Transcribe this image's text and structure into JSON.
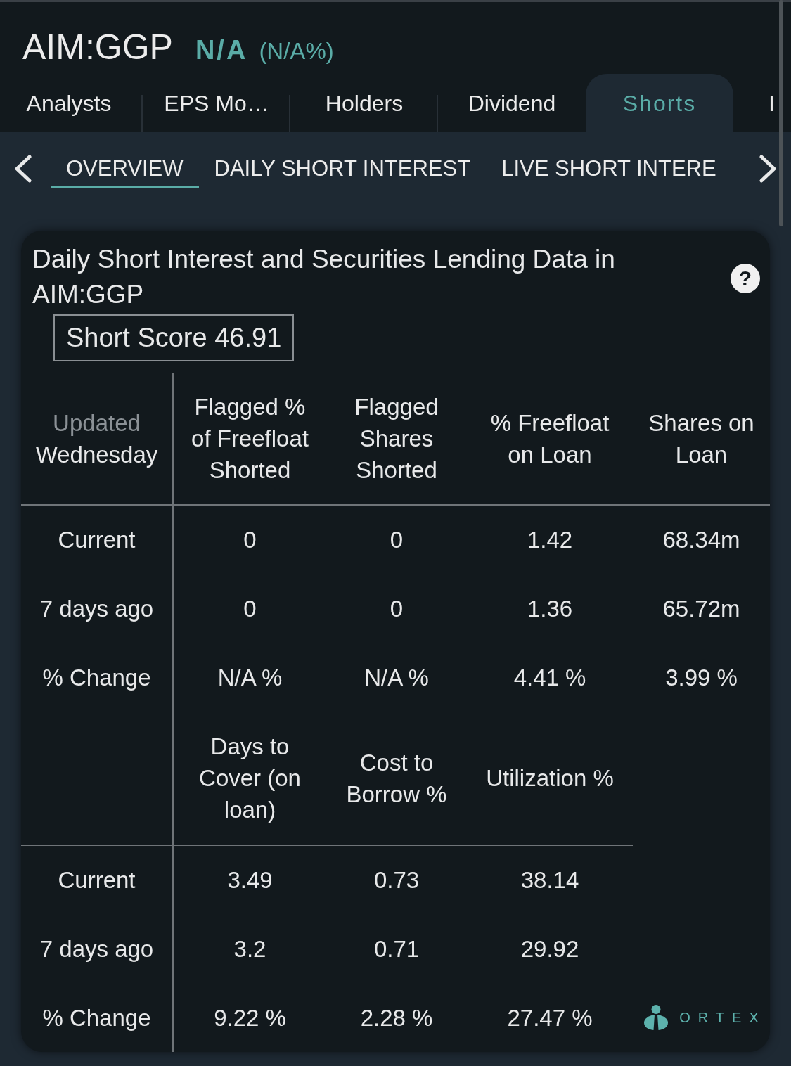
{
  "header": {
    "symbol": "AIM:GGP",
    "price": "N/A",
    "change": "(N/A%)"
  },
  "tabs": [
    {
      "label": "Analysts",
      "selected": false
    },
    {
      "label": "EPS Mo…",
      "selected": false
    },
    {
      "label": "Holders",
      "selected": false
    },
    {
      "label": "Dividend",
      "selected": false
    },
    {
      "label": "Shorts",
      "selected": true
    },
    {
      "label": "I",
      "selected": false
    }
  ],
  "subtabs": [
    {
      "label": "OVERVIEW",
      "selected": true
    },
    {
      "label": "DAILY SHORT INTEREST",
      "selected": false
    },
    {
      "label": "LIVE SHORT INTERE",
      "selected": false
    }
  ],
  "card": {
    "title": "Daily Short Interest and Securities Lending Data in AIM:GGP",
    "help": "?",
    "short_score": "Short Score 46.91",
    "sections": [
      {
        "corner": {
          "label": "Updated",
          "value": "Wednesday"
        },
        "columns": [
          "Flagged % of Freefloat Shorted",
          "Flagged Shares Shorted",
          "% Freefloat on Loan",
          "Shares on Loan"
        ],
        "rows": [
          {
            "label": "Current",
            "values": [
              "0",
              "0",
              "1.42",
              "68.34m"
            ]
          },
          {
            "label": "7 days ago",
            "values": [
              "0",
              "0",
              "1.36",
              "65.72m"
            ]
          },
          {
            "label": "% Change",
            "values": [
              "N/A %",
              "N/A %",
              "4.41 %",
              "3.99 %"
            ]
          }
        ]
      },
      {
        "columns": [
          "Days to Cover (on loan)",
          "Cost to Borrow %",
          "Utilization %"
        ],
        "rows": [
          {
            "label": "Current",
            "values": [
              "3.49",
              "0.73",
              "38.14"
            ]
          },
          {
            "label": "7 days ago",
            "values": [
              "3.2",
              "0.71",
              "29.92"
            ]
          },
          {
            "label": "% Change",
            "values": [
              "9.22 %",
              "2.28 %",
              "27.47 %"
            ]
          }
        ]
      }
    ],
    "brand": "ORTEX"
  }
}
